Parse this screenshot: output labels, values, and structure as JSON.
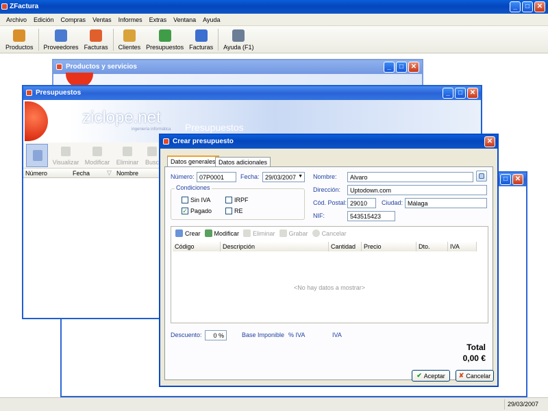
{
  "app": {
    "title": "ZFactura"
  },
  "menu": [
    "Archivo",
    "Edición",
    "Compras",
    "Ventas",
    "Informes",
    "Extras",
    "Ventana",
    "Ayuda"
  ],
  "toolbar": [
    {
      "label": "Productos",
      "icon": "boxes-icon",
      "color": "#d9902b"
    },
    {
      "label": "Proveedores",
      "icon": "suppliers-icon",
      "color": "#4a7bd0"
    },
    {
      "label": "Facturas",
      "icon": "invoice-icon",
      "color": "#e0602d"
    },
    {
      "label": "Clientes",
      "icon": "clients-icon",
      "color": "#d9a23a"
    },
    {
      "label": "Presupuestos",
      "icon": "budget-icon",
      "color": "#3f9d48"
    },
    {
      "label": "Facturas",
      "icon": "invoice-icon",
      "color": "#3b6fd0"
    },
    {
      "label": "Ayuda (F1)",
      "icon": "help-icon",
      "color": "#6c7d96"
    }
  ],
  "windows": {
    "productos": {
      "title": "Productos y servicios"
    },
    "presupuestos": {
      "title": "Presupuestos",
      "logo": "ziclope.net",
      "logo_sub": "ingeniería informática",
      "banner": "Presupuestos",
      "tools": [
        "Visualizar",
        "Modificar",
        "Eliminar",
        "Busc"
      ],
      "columns": [
        "Número",
        "Fecha",
        "Nombre"
      ]
    }
  },
  "dialog": {
    "title": "Crear presupuesto",
    "tabs": [
      "Datos generales",
      "Datos adicionales"
    ],
    "numero_label": "Número:",
    "numero": "07P0001",
    "fecha_label": "Fecha:",
    "fecha": "29/03/2007",
    "condiciones_label": "Condiciones",
    "checks": {
      "sin_iva": {
        "label": "Sin IVA",
        "checked": false
      },
      "irpf": {
        "label": "IRPF",
        "checked": false
      },
      "pagado": {
        "label": "Pagado",
        "checked": true
      },
      "re": {
        "label": "RE",
        "checked": false
      }
    },
    "nombre_label": "Nombre:",
    "nombre": "Alvaro",
    "direccion_label": "Dirección:",
    "direccion": "Uptodown.com",
    "cp_label": "Cód. Postal:",
    "cp": "29010",
    "ciudad_label": "Ciudad:",
    "ciudad": "Málaga",
    "nif_label": "NIF:",
    "nif": "543515423",
    "grid_tools": [
      "Crear",
      "Modificar",
      "Eliminar",
      "Grabar",
      "Cancelar"
    ],
    "grid_columns": [
      "Código",
      "Descripción",
      "Cantidad",
      "Precio",
      "Dto.",
      "IVA"
    ],
    "empty_text": "<No hay datos a mostrar>",
    "descuento_label": "Descuento:",
    "descuento": "0 %",
    "base_label": "Base Imponible",
    "piva_label": "% IVA",
    "iva_label": "IVA",
    "total_label": "Total",
    "total": "0,00 €",
    "aceptar": "Aceptar",
    "cancelar": "Cancelar"
  },
  "status": {
    "date": "29/03/2007"
  }
}
